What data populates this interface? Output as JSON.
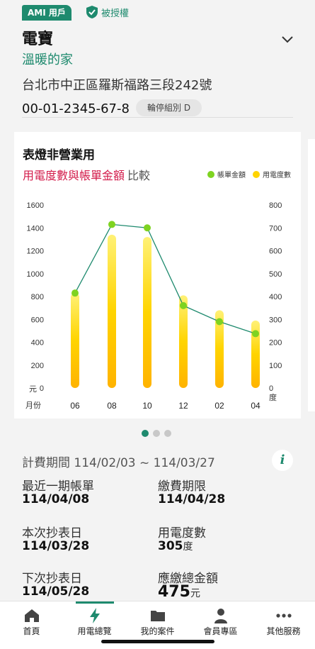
{
  "header": {
    "badge": "AMI 用戶",
    "auth_label": "被授權",
    "title": "電寶",
    "subtitle": "溫暖的家",
    "address": "台北市中正區羅斯福路三段242號",
    "account_no": "00-01-2345-67-8",
    "group_label": "輪停組別 D"
  },
  "chart_card": {
    "title": "表燈非營業用",
    "subtitle_highlight": "用電度數與帳單金額",
    "subtitle_rest": "比較",
    "left_unit": "元",
    "right_unit": "度",
    "x_label": "月份"
  },
  "chart_data": {
    "type": "bar",
    "categories": [
      "06",
      "08",
      "10",
      "12",
      "02",
      "04"
    ],
    "series": [
      {
        "name": "用電度數",
        "type": "bar",
        "axis": "right",
        "color": "#ffd400",
        "values": [
          415,
          670,
          660,
          405,
          340,
          295
        ]
      },
      {
        "name": "帳單金額",
        "type": "line",
        "axis": "left",
        "color": "#7ed321",
        "values": [
          830,
          1430,
          1400,
          720,
          580,
          475
        ]
      }
    ],
    "y_left": {
      "ticks": [
        0,
        200,
        400,
        600,
        800,
        1000,
        1200,
        1400,
        1600
      ],
      "range": [
        0,
        1600
      ]
    },
    "y_right": {
      "ticks": [
        0,
        100,
        200,
        300,
        400,
        500,
        600,
        700,
        800
      ],
      "range": [
        0,
        800
      ]
    },
    "legend": [
      "帳單金額",
      "用電度數"
    ]
  },
  "pager": {
    "pages": 3,
    "active": 0
  },
  "billing": {
    "period": "計費期間 114/02/03 ~ 114/03/27",
    "recent_bill_label": "最近一期帳單",
    "recent_bill_value": "114/04/08",
    "due_label": "繳費期限",
    "due_value": "114/04/28",
    "read_label": "本次抄表日",
    "read_value": "114/03/28",
    "usage_label": "用電度數",
    "usage_value": "305",
    "usage_unit": "度",
    "next_read_label": "下次抄表日",
    "next_read_value": "114/05/28",
    "total_label": "應繳總金額",
    "total_value": "475",
    "total_unit": "元"
  },
  "tabs": [
    {
      "label": "首頁",
      "icon": "home-icon"
    },
    {
      "label": "用電總覽",
      "icon": "bolt-icon",
      "active": true
    },
    {
      "label": "我的案件",
      "icon": "folder-icon"
    },
    {
      "label": "會員專區",
      "icon": "person-icon"
    },
    {
      "label": "其他服務",
      "icon": "more-icon"
    }
  ],
  "colors": {
    "brand": "#1e8a6e",
    "accent": "#d31c4b",
    "bar": "#ffd400",
    "line": "#7ed321"
  }
}
